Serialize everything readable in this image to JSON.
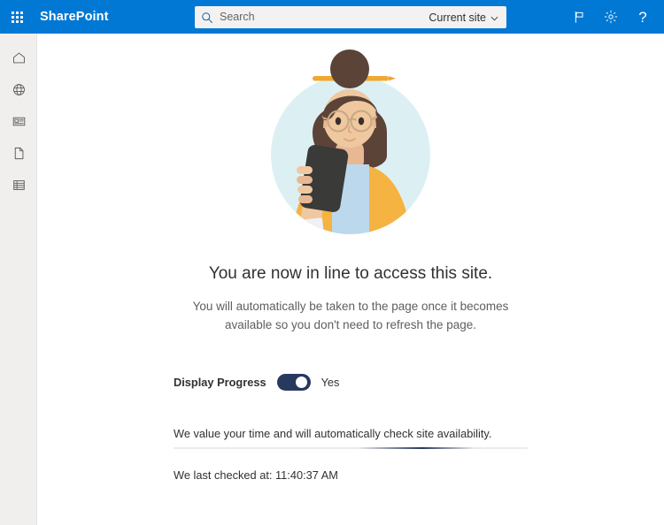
{
  "header": {
    "waffle_icon": "app-launcher-waffle-icon",
    "brand": "SharePoint",
    "search": {
      "icon": "search-icon",
      "placeholder": "Search",
      "value": "",
      "scope_label": "Current site",
      "scope_chevron": "chevron-down-icon"
    },
    "actions": [
      {
        "name": "flag-icon",
        "label": ""
      },
      {
        "name": "gear-icon",
        "label": ""
      },
      {
        "name": "help-icon",
        "label": "?"
      }
    ],
    "background_color": "#0078d4"
  },
  "rail": {
    "items": [
      {
        "icon": "home-icon",
        "label": "Home"
      },
      {
        "icon": "globe-icon",
        "label": "Web"
      },
      {
        "icon": "news-icon",
        "label": "News"
      },
      {
        "icon": "page-icon",
        "label": "Pages"
      },
      {
        "icon": "list-icon",
        "label": "Lists"
      }
    ]
  },
  "main": {
    "illustration": {
      "name": "person-holding-phone-illustration",
      "colors": {
        "circle_bg": "#dcf0f4",
        "hair": "#5b4338",
        "hair_stick": "#f0a831",
        "skin": "#f0c8a0",
        "jacket": "#f5b342",
        "shirt": "#bcd8ec",
        "phone": "#3a3a38"
      }
    },
    "headline": "You are now in line to access this site.",
    "subcopy_line1": "You will automatically be taken to the page once it becomes available",
    "subcopy_line2": "so you don't need to refresh the page.",
    "toggle": {
      "label": "Display Progress",
      "state_label": "Yes",
      "checked": true,
      "on_color": "#27395e"
    },
    "status_text": "We value your time and will automatically check site availability.",
    "progress": {
      "indeterminate": true,
      "accent_color": "#27395e",
      "track_color": "#edebe9"
    },
    "last_checked_text": "We last checked at: 11:40:37 AM"
  }
}
